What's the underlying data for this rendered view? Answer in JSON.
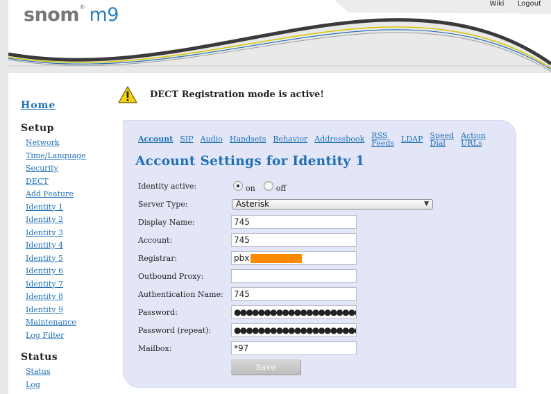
{
  "header": {
    "logo_brand": "snom",
    "logo_model": "m9",
    "links": {
      "wiki": "Wiki",
      "logout": "Logout"
    }
  },
  "sidebar": {
    "home": "Home",
    "setup_title": "Setup",
    "setup_items": [
      "Network",
      "Time/Language",
      "Security",
      "DECT",
      "Add Feature",
      "Identity 1",
      "Identity 2",
      "Identity 3",
      "Identity 4",
      "Identity 5",
      "Identity 6",
      "Identity 7",
      "Identity 8",
      "Identity 9",
      "Maintenance",
      "Log Filter"
    ],
    "status_title": "Status",
    "status_items": [
      "Status",
      "Log"
    ]
  },
  "alert": {
    "icon": "warning-icon",
    "text": "DECT Registration mode is active!"
  },
  "tabs": [
    {
      "l1": "Account",
      "l2": ""
    },
    {
      "l1": "SIP",
      "l2": ""
    },
    {
      "l1": "Audio",
      "l2": ""
    },
    {
      "l1": "Handsets",
      "l2": ""
    },
    {
      "l1": "Behavior",
      "l2": ""
    },
    {
      "l1": "Addressbook",
      "l2": ""
    },
    {
      "l1": "RSS",
      "l2": "Feeds"
    },
    {
      "l1": "LDAP",
      "l2": ""
    },
    {
      "l1": "Speed",
      "l2": "Dial"
    },
    {
      "l1": "Action",
      "l2": "URLs"
    }
  ],
  "form": {
    "title": "Account Settings for Identity 1",
    "identity_active": {
      "label": "Identity active:",
      "on": "on",
      "off": "off",
      "selected": "on"
    },
    "server_type": {
      "label": "Server Type:",
      "value": "Asterisk"
    },
    "display_name": {
      "label": "Display Name:",
      "value": "745"
    },
    "account": {
      "label": "Account:",
      "value": "745"
    },
    "registrar": {
      "label": "Registrar:",
      "value": "pbx"
    },
    "outbound_proxy": {
      "label": "Outbound Proxy:",
      "value": ""
    },
    "auth_name": {
      "label": "Authentication Name:",
      "value": "745"
    },
    "password": {
      "label": "Password:",
      "value": "●●●●●●●●●●●●●●●●●●●●●●"
    },
    "password_repeat": {
      "label": "Password (repeat):",
      "value": "●●●●●●●●●●●●●●●●●●●●●●"
    },
    "mailbox": {
      "label": "Mailbox:",
      "value": "*97"
    },
    "save_label": "Save"
  },
  "colors": {
    "link": "#1f6fb5",
    "panel": "#e2e6f7",
    "warning": "#f5d20a",
    "redaction": "#ff8a00"
  }
}
